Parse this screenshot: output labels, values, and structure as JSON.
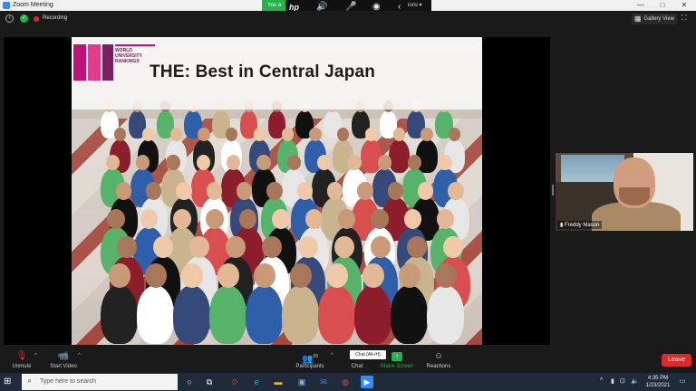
{
  "window": {
    "title": "Zoom Meeting",
    "minimize": "—",
    "maximize": "□",
    "close": "✕"
  },
  "overlay": {
    "pill_text": "You a",
    "hp_logo": "hp",
    "options_text": "ions ▾",
    "icons": [
      "hp-logo-icon",
      "speaker-icon",
      "mic-icon",
      "ring-icon",
      "chevron-left-icon"
    ]
  },
  "topbar": {
    "recording": "Recording",
    "gallery_view": "Gallery View"
  },
  "slide": {
    "title": "THE: Best in Central Japan",
    "logo_text": [
      "WORLD",
      "UNIVERSITY",
      "RANKINGS"
    ]
  },
  "participant": {
    "name": "Freddy Mason"
  },
  "toolbar": {
    "unmute": "Unmute",
    "start_video": "Start Video",
    "participants": "Participants",
    "participants_count": "69",
    "chat": "Chat",
    "chat_tooltip": "Chat (Alt+H)",
    "share_screen": "Share Screen",
    "reactions": "Reactions",
    "leave": "Leave"
  },
  "taskbar": {
    "search_placeholder": "Type here to search",
    "time": "4:35 PM",
    "date": "1/23/2021"
  },
  "colors": {
    "zoom_blue": "#2d8cff",
    "share_green": "#23b24b",
    "leave_red": "#e02828",
    "taskbar": "#1f2b3a",
    "logo_magenta": "#c0107a"
  }
}
